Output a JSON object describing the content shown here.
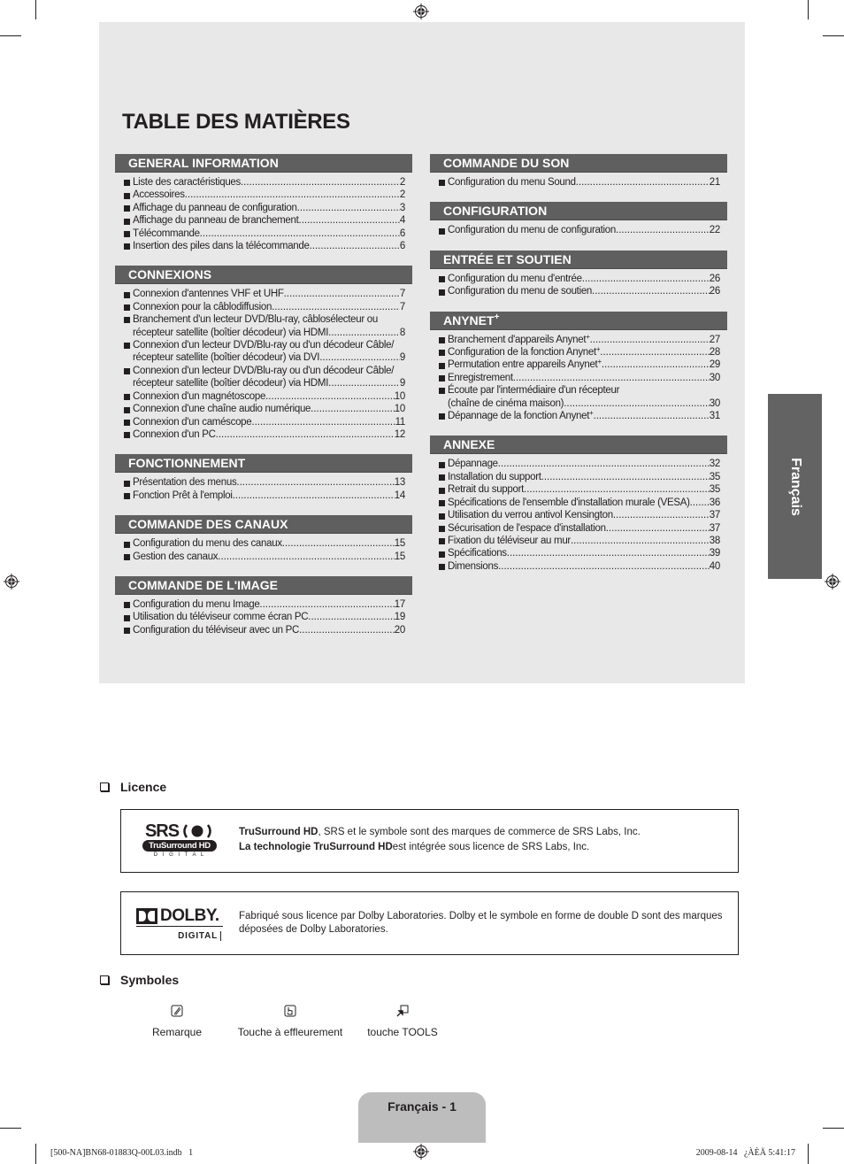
{
  "toc": {
    "title": "TABLE DES MATIÈRES",
    "left_sections": [
      {
        "heading": "GENERAL INFORMATION",
        "items": [
          {
            "text": "Liste des caractéristiques",
            "page": "2"
          },
          {
            "text": "Accessoires",
            "page": "2"
          },
          {
            "text": "Affichage du panneau de configuration",
            "page": "3"
          },
          {
            "text": "Affichage du panneau de branchement",
            "page": "4"
          },
          {
            "text": "Télécommande",
            "page": "6"
          },
          {
            "text": "Insertion des piles dans la télécommande",
            "page": "6"
          }
        ]
      },
      {
        "heading": "CONNEXIONS",
        "items": [
          {
            "text": "Connexion d'antennes VHF et UHF",
            "page": "7"
          },
          {
            "text": "Connexion pour la câblodiffusion",
            "page": "7"
          },
          {
            "text": "Branchement d'un lecteur DVD/Blu-ray, câblosélecteur ou",
            "text2": "récepteur satellite (boîtier décodeur) via HDMI",
            "page": "8"
          },
          {
            "text": "Connexion d'un lecteur DVD/Blu-ray ou d'un décodeur Câble/",
            "text2": "récepteur satellite (boîtier décodeur) via DVI",
            "page": "9"
          },
          {
            "text": "Connexion d'un lecteur DVD/Blu-ray ou d'un décodeur Câble/",
            "text2": "récepteur satellite (boîtier décodeur) via HDMI",
            "page": "9"
          },
          {
            "text": "Connexion d'un magnétoscope",
            "page": "10"
          },
          {
            "text": "Connexion d'une chaîne audio numérique",
            "page": "10"
          },
          {
            "text": "Connexion d'un caméscope",
            "page": "11"
          },
          {
            "text": "Connexion d'un PC",
            "page": "12"
          }
        ]
      },
      {
        "heading": "FONCTIONNEMENT",
        "items": [
          {
            "text": "Présentation des menus",
            "page": "13"
          },
          {
            "text": "Fonction Prêt à l'emploi",
            "page": "14"
          }
        ]
      },
      {
        "heading": "COMMANDE DES CANAUX",
        "items": [
          {
            "text": "Configuration du menu des canaux",
            "page": "15"
          },
          {
            "text": "Gestion des canaux",
            "page": "15"
          }
        ]
      },
      {
        "heading": "COMMANDE DE L'IMAGE",
        "items": [
          {
            "text": "Configuration du menu Image",
            "page": "17"
          },
          {
            "text": "Utilisation du téléviseur comme écran PC",
            "page": "19"
          },
          {
            "text": "Configuration du téléviseur avec un PC",
            "page": "20"
          }
        ]
      }
    ],
    "right_sections": [
      {
        "heading": "COMMANDE DU SON",
        "items": [
          {
            "text": "Configuration du menu Sound",
            "page": "21"
          }
        ]
      },
      {
        "heading": "CONFIGURATION",
        "items": [
          {
            "text": "Configuration du menu de configuration",
            "page": "22"
          }
        ]
      },
      {
        "heading": "ENTRÉE ET SOUTIEN",
        "items": [
          {
            "text": "Configuration du menu d'entrée",
            "page": "26"
          },
          {
            "text": "Configuration du menu de soutien",
            "page": "26"
          }
        ]
      },
      {
        "heading": "ANYNET",
        "heading_sup": "+",
        "items": [
          {
            "text": "Branchement d'appareils Anynet",
            "sup": "+",
            "page": "27"
          },
          {
            "text": "Configuration de la fonction Anynet",
            "sup": "+",
            "page": "28"
          },
          {
            "text": "Permutation entre appareils Anynet",
            "sup": "+",
            "page": "29"
          },
          {
            "text": "Enregistrement",
            "page": "30"
          },
          {
            "text": "Écoute par l'intermédiaire d'un récepteur",
            "text2": "(chaîne de cinéma maison)",
            "page": "30"
          },
          {
            "text": "Dépannage de la fonction Anynet",
            "sup": "+",
            "page": "31"
          }
        ]
      },
      {
        "heading": "ANNEXE",
        "items": [
          {
            "text": "Dépannage",
            "page": "32"
          },
          {
            "text": "Installation du support",
            "page": "35"
          },
          {
            "text": "Retrait du support",
            "page": "35"
          },
          {
            "text": "Spécifications de l'ensemble d'installation murale (VESA)",
            "page": "36"
          },
          {
            "text": "Utilisation du verrou antivol Kensington",
            "page": "37"
          },
          {
            "text": "Sécurisation de l'espace d'installation",
            "page": "37"
          },
          {
            "text": "Fixation du téléviseur au mur",
            "page": "38"
          },
          {
            "text": "Spécifications",
            "page": "39"
          },
          {
            "text": "Dimensions",
            "page": "40"
          }
        ]
      }
    ]
  },
  "side_tab": {
    "label": "Français"
  },
  "licence": {
    "heading": "Licence",
    "srs": {
      "logo_top": "SRS",
      "logo_mid": "TruSurround HD",
      "logo_bottom": "D I G I T A L",
      "line1_bold": "TruSurround HD",
      "line1_rest": ", SRS et le symbole sont des marques de commerce de SRS Labs, Inc.",
      "line2_bold": "La technologie TruSurround HD",
      "line2_rest": "est intégrée sous licence de SRS Labs, Inc."
    },
    "dolby": {
      "logo_top": "DOLBY.",
      "logo_bottom": "DIGITAL",
      "line1": "Fabriqué sous licence par Dolby Laboratories. Dolby et le symbole en forme de double D sont des marques",
      "line2": "déposées de Dolby Laboratories."
    }
  },
  "symbols": {
    "heading": "Symboles",
    "items": [
      {
        "icon": "note-icon",
        "label": "Remarque"
      },
      {
        "icon": "touch-button-icon",
        "label": "Touche à effleurement"
      },
      {
        "icon": "tools-button-icon",
        "label": "touche TOOLS"
      }
    ]
  },
  "footer": {
    "page_label": "Français - 1",
    "file_name": "[500-NA]BN68-01883Q-00L03.indb   1",
    "timestamp": "2009-08-14   ¿ÀÈÄ 5:41:17"
  }
}
